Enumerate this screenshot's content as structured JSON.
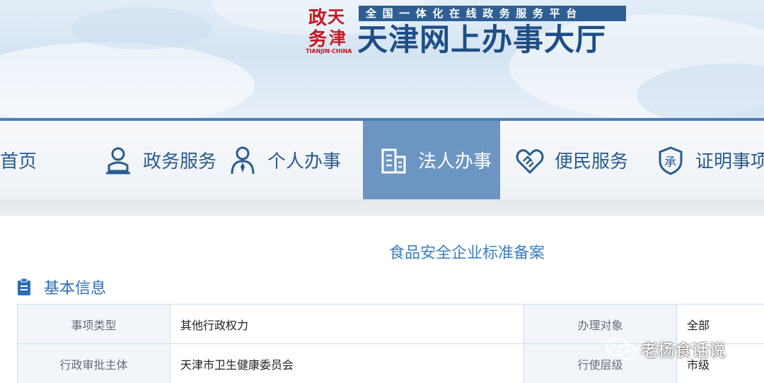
{
  "header": {
    "seal_text": "天津政务网",
    "seal_en": "TIANJIN·CHINA",
    "slogan": "全国一体化在线政务服务平台",
    "title": "天津网上办事大厅"
  },
  "nav": {
    "items": [
      {
        "label": "首页",
        "icon": "home-icon",
        "active": false
      },
      {
        "label": "政务服务",
        "icon": "user-badge-icon",
        "active": false
      },
      {
        "label": "个人办事",
        "icon": "person-tie-icon",
        "active": false
      },
      {
        "label": "法人办事",
        "icon": "building-icon",
        "active": true
      },
      {
        "label": "便民服务",
        "icon": "handshake-icon",
        "active": false
      },
      {
        "label": "证明事项",
        "icon": "shield-cheng-icon",
        "active": false
      }
    ],
    "active_color": "#6d95c3",
    "text_color": "#2a5b8f"
  },
  "page": {
    "title": "食品安全企业标准备案"
  },
  "section": {
    "icon": "clipboard-icon",
    "title": "基本信息"
  },
  "table": {
    "rows": [
      {
        "label1": "事项类型",
        "value1": "其他行政权力",
        "label2": "办理对象",
        "value2": "全部"
      },
      {
        "label1": "行政审批主体",
        "value1": "天津市卫生健康委员会",
        "label2": "行使层级",
        "value2": "市级"
      }
    ]
  },
  "watermark": {
    "icon": "wechat-icon",
    "text": "老杨食话说"
  }
}
